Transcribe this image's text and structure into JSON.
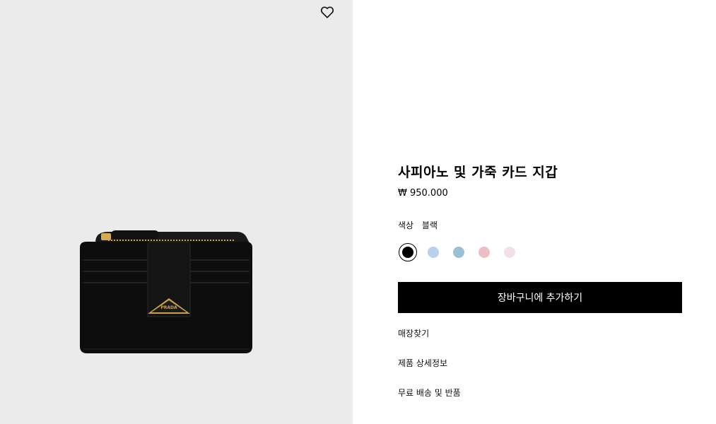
{
  "product": {
    "title": "사피아노 및 가죽 카드 지갑",
    "price": "₩ 950.000",
    "color_label": "색상",
    "color_value": "블랙",
    "brand_plate": "PRADA"
  },
  "swatches": [
    {
      "name": "블랙",
      "color": "#000000",
      "selected": true
    },
    {
      "name": "light-blue",
      "color": "#b9d0ee",
      "selected": false
    },
    {
      "name": "steel-blue",
      "color": "#9ac0d8",
      "selected": false
    },
    {
      "name": "pink",
      "color": "#ecbfc4",
      "selected": false
    },
    {
      "name": "pale-pink",
      "color": "#f4e1e6",
      "selected": false
    }
  ],
  "actions": {
    "add_to_cart": "장바구니에 추가하기",
    "find_store": "매장찾기",
    "details": "제품 상세정보",
    "shipping": "무료 배송 및 반품"
  },
  "icons": {
    "wishlist": "heart-outline-icon"
  },
  "colors": {
    "image_bg": "#ebebeb",
    "button_bg": "#000000",
    "button_text": "#ffffff"
  }
}
